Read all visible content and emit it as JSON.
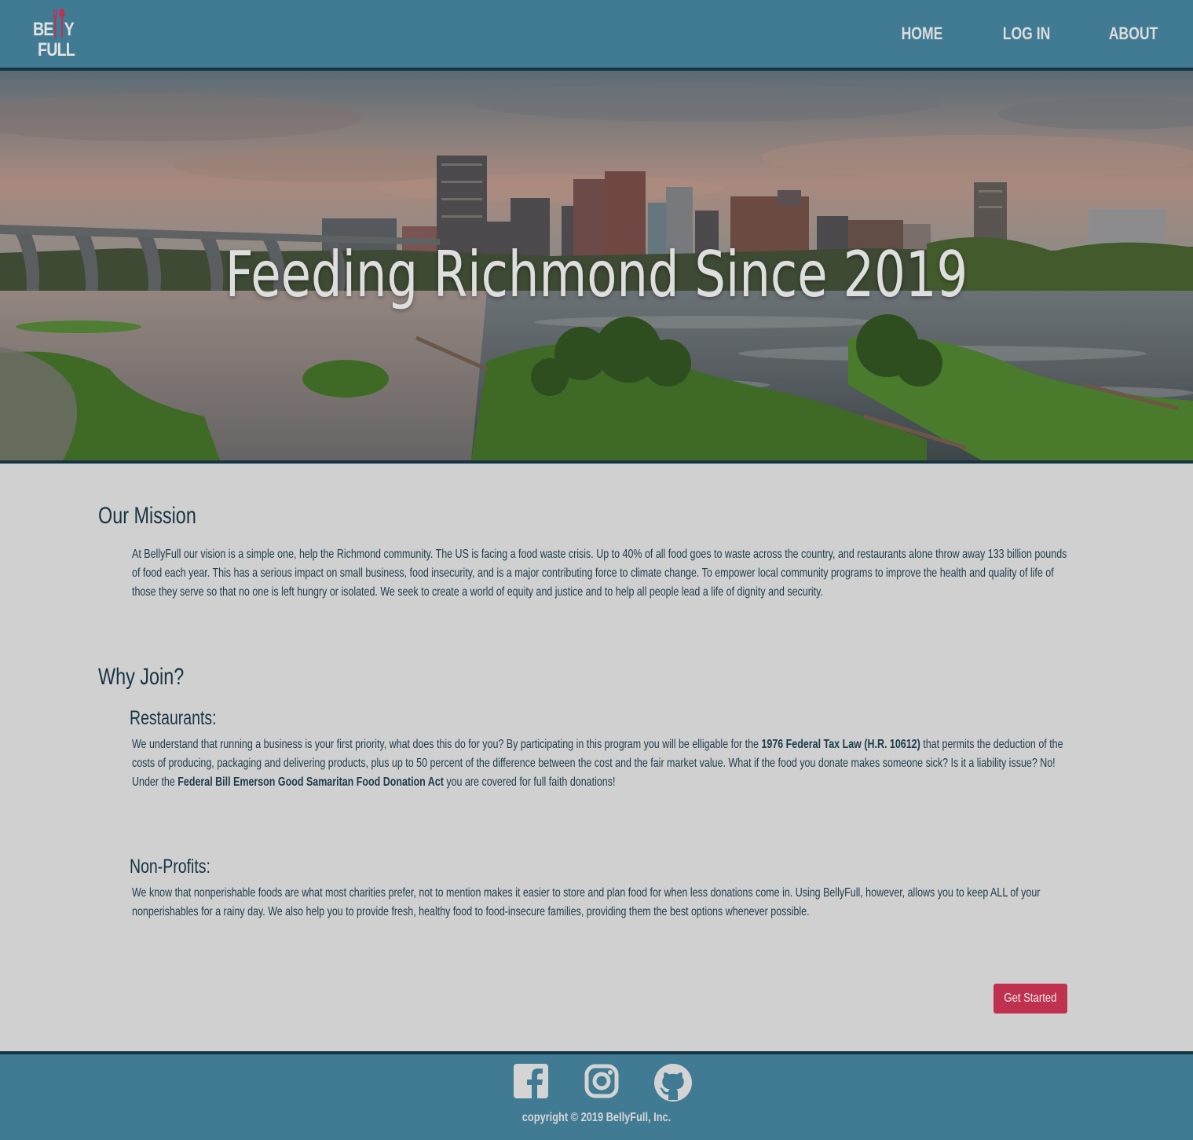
{
  "brand": {
    "logo_top": "BE",
    "logo_top_end": "Y",
    "logo_bottom": "FULL",
    "accent_color": "#c0304f",
    "header_color": "#407b93",
    "dark_color": "#173444"
  },
  "nav": {
    "home": "HOME",
    "login": "LOG IN",
    "about": "ABOUT"
  },
  "hero": {
    "title": "Feeding Richmond Since 2019"
  },
  "mission": {
    "title": "Our Mission",
    "body": "At BellyFull our vision is a simple one, help the Richmond community. The US is facing a food waste crisis. Up to 40% of all food goes to waste across the country, and restaurants alone throw away 133 billion pounds of food each year. This has a serious impact on small business, food insecurity, and is a major contributing force to climate change. To empower local community programs to improve the health and quality of life of those they serve so that no one is left hungry or isolated. We seek to create a world of equity and justice and to help all people lead a life of dignity and security."
  },
  "why_join": {
    "title": "Why Join?",
    "restaurants": {
      "title": "Restaurants:",
      "text_1": "We understand that running a business is your first priority, what does this do for you? By participating in this program you will be elligable for the ",
      "bold_1": "1976 Federal Tax Law (H.R. 10612)",
      "text_2": " that permits the deduction of the costs of producing, packaging and delivering products, plus up to 50 percent of the difference between the cost and the fair market value. What if the food you donate makes someone sick? Is it a liability issue? No! Under the ",
      "bold_2": "Federal Bill Emerson Good Samaritan Food Donation Act",
      "text_3": " you are covered for full faith donations!"
    },
    "nonprofits": {
      "title": "Non-Profits:",
      "body": "We know that nonperishable foods are what most charities prefer, not to mention makes it easier to store and plan food for when less donations come in. Using BellyFull, however, allows you to keep ALL of your nonperishables for a rainy day. We also help you to provide fresh, healthy food to food-insecure families, providing them the best options whenever possible."
    }
  },
  "cta": {
    "label": "Get Started"
  },
  "footer": {
    "icons": [
      "facebook-icon",
      "instagram-icon",
      "github-icon"
    ],
    "copyright": "copyright © 2019 BellyFull, Inc."
  }
}
